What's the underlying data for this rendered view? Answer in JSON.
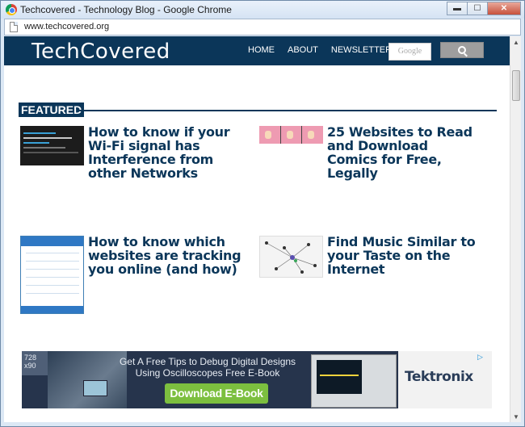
{
  "window": {
    "title": "Techcovered - Technology Blog - Google Chrome",
    "address": "www.techcovered.org"
  },
  "site": {
    "logo": "TechCovered",
    "nav": [
      "HOME",
      "ABOUT",
      "NEWSLETTER"
    ],
    "search_placeholder": "Google"
  },
  "featured": {
    "label": "FEATURED",
    "articles": [
      {
        "title": "How to know if your Wi-Fi signal has Interference from other Networks"
      },
      {
        "title": "25 Websites to Read and Download Comics for Free, Legally"
      },
      {
        "title": "How to know which websites are tracking you online (and how)"
      },
      {
        "title": "Find Music Similar to your Taste on the Internet"
      }
    ]
  },
  "ad": {
    "size": "728\nx90",
    "headline": "Get A Free Tips to Debug Digital Designs Using Oscilloscopes Free E-Book",
    "cta": "Download E-Book",
    "brand": "Tektronix"
  },
  "colors": {
    "header_bg": "#0b3659",
    "title_blue": "#0b3659",
    "cta_green": "#7cbf3f"
  }
}
